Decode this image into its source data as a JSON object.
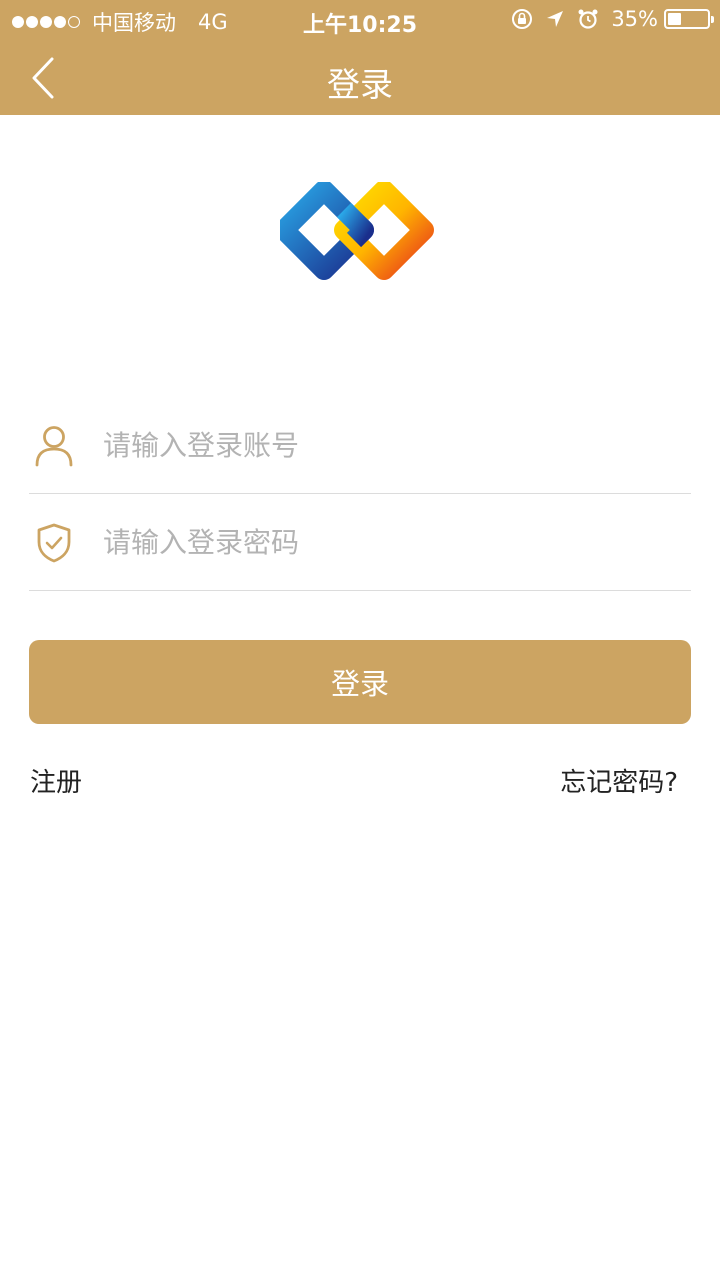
{
  "status_bar": {
    "carrier": "中国移动",
    "network": "4G",
    "time": "上午10:25",
    "battery": "35%",
    "battery_level": 0.35,
    "icons": [
      "signal-dots-icon",
      "orientation-lock-icon",
      "location-arrow-icon",
      "alarm-icon",
      "battery-icon"
    ]
  },
  "nav": {
    "title": "登录",
    "back_icon": "chevron-left-icon"
  },
  "logo": {
    "name": "brand-logo"
  },
  "form": {
    "account": {
      "placeholder": "请输入登录账号",
      "value": "",
      "icon": "user-icon"
    },
    "password": {
      "placeholder": "请输入登录密码",
      "value": "",
      "icon": "shield-check-icon"
    },
    "submit_label": "登录"
  },
  "links": {
    "register": "注册",
    "forgot": "忘记密码?"
  },
  "colors": {
    "brand": "#CCA462",
    "background": "#FFFFFF",
    "placeholder": "#B3B3B3",
    "divider": "#DCDCDC"
  }
}
